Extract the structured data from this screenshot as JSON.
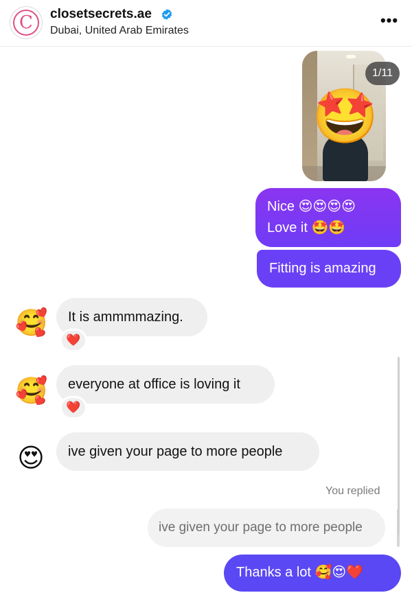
{
  "header": {
    "account_name": "closetsecrets.ae",
    "location": "Dubai, United Arab Emirates",
    "avatar_letter": "C",
    "more_label": "•••",
    "verified_color": "#1d9bf0",
    "brand_color": "#e04f86"
  },
  "photo": {
    "count_label": "1/11",
    "face_sticker": "🤩"
  },
  "messages_out": [
    {
      "line1": "Nice 😍😍😍😍",
      "line2": "Love it 🤩🤩"
    },
    {
      "text": "Fitting is amazing"
    }
  ],
  "messages_in": [
    {
      "text": "It is ammmmazing.",
      "avatar_emoji": "🥰",
      "reaction": "❤️"
    },
    {
      "text": "everyone at office is loving it",
      "avatar_emoji": "🥰",
      "reaction": "❤️"
    },
    {
      "text": "ive given your page to more people",
      "avatar_emoji": "😍"
    }
  ],
  "reply": {
    "label": "You replied",
    "quoted_text": "ive given your page to more people",
    "text": "Thanks a lot 🥰😍❤️"
  },
  "colors": {
    "outgoing_bubble": "#7b2ff5",
    "incoming_bubble": "#efefef"
  }
}
